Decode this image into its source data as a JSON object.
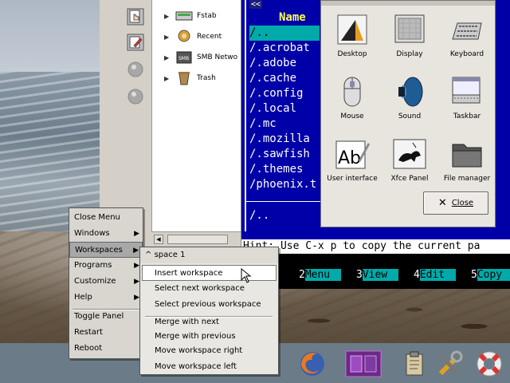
{
  "colors": {
    "mc_bg": "#0000a8",
    "mc_text": "#ffffff",
    "mc_header": "#ffff55",
    "mc_highlight": "#00aaaa",
    "menu_bg": "#d9d6d0"
  },
  "file_manager": {
    "places": [
      {
        "label": "Fstab",
        "icon": "drive-icon"
      },
      {
        "label": "Recent",
        "icon": "recent-icon"
      },
      {
        "label": "SMB Netwo",
        "icon": "smb-icon"
      },
      {
        "label": "Trash",
        "icon": "trash-icon"
      }
    ]
  },
  "mc": {
    "title_arrows": "<<",
    "header": "Name",
    "files": [
      "..",
      ".acrobat",
      ".adobe",
      ".cache",
      ".config",
      ".local",
      ".mc",
      ".mozilla",
      ".sawfish",
      ".themes",
      "phoenix.t"
    ],
    "current": "/..",
    "right_column": [
      "/",
      "/.",
      "/.",
      "/.",
      "/.",
      "/.",
      "/.",
      "/.",
      "/.",
      "/.",
      "/.",
      "/p"
    ],
    "hint": "Hint: Use C-x p to copy the current pa",
    "fkeys": [
      {
        "num": "2",
        "label": "Menu"
      },
      {
        "num": "3",
        "label": "View"
      },
      {
        "num": "4",
        "label": "Edit"
      },
      {
        "num": "5",
        "label": "Copy"
      }
    ]
  },
  "settings": {
    "items": [
      {
        "label": "Desktop",
        "icon": "desktop-icon"
      },
      {
        "label": "Display",
        "icon": "display-icon"
      },
      {
        "label": "Keyboard",
        "icon": "keyboard-icon"
      },
      {
        "label": "Mouse",
        "icon": "mouse-icon"
      },
      {
        "label": "Sound",
        "icon": "sound-icon"
      },
      {
        "label": "Taskbar",
        "icon": "taskbar-icon"
      },
      {
        "label": "User interface",
        "icon": "user-interface-icon"
      },
      {
        "label": "Xfce Panel",
        "icon": "xfce-panel-icon"
      },
      {
        "label": "File manager",
        "icon": "file-manager-icon"
      }
    ],
    "close_label": "Close"
  },
  "root_menu": {
    "items": [
      "Close Menu",
      "Windows",
      "Workspaces",
      "Programs",
      "Customize",
      "Help"
    ],
    "bottom_items": [
      "Toggle Panel",
      "Restart",
      "Reboot"
    ]
  },
  "workspace_menu": {
    "title": "space 1",
    "items": [
      "Insert workspace",
      "Select next workspace",
      "Select previous workspace"
    ],
    "items2": [
      "Merge with next",
      "Merge with previous",
      "Move workspace right",
      "Move workspace left"
    ]
  },
  "taskbar": {
    "icons": [
      "firefox-icon",
      "workspace-pager-icon",
      "clipboard-icon",
      "tools-icon",
      "help-lifebuoy-icon"
    ]
  }
}
